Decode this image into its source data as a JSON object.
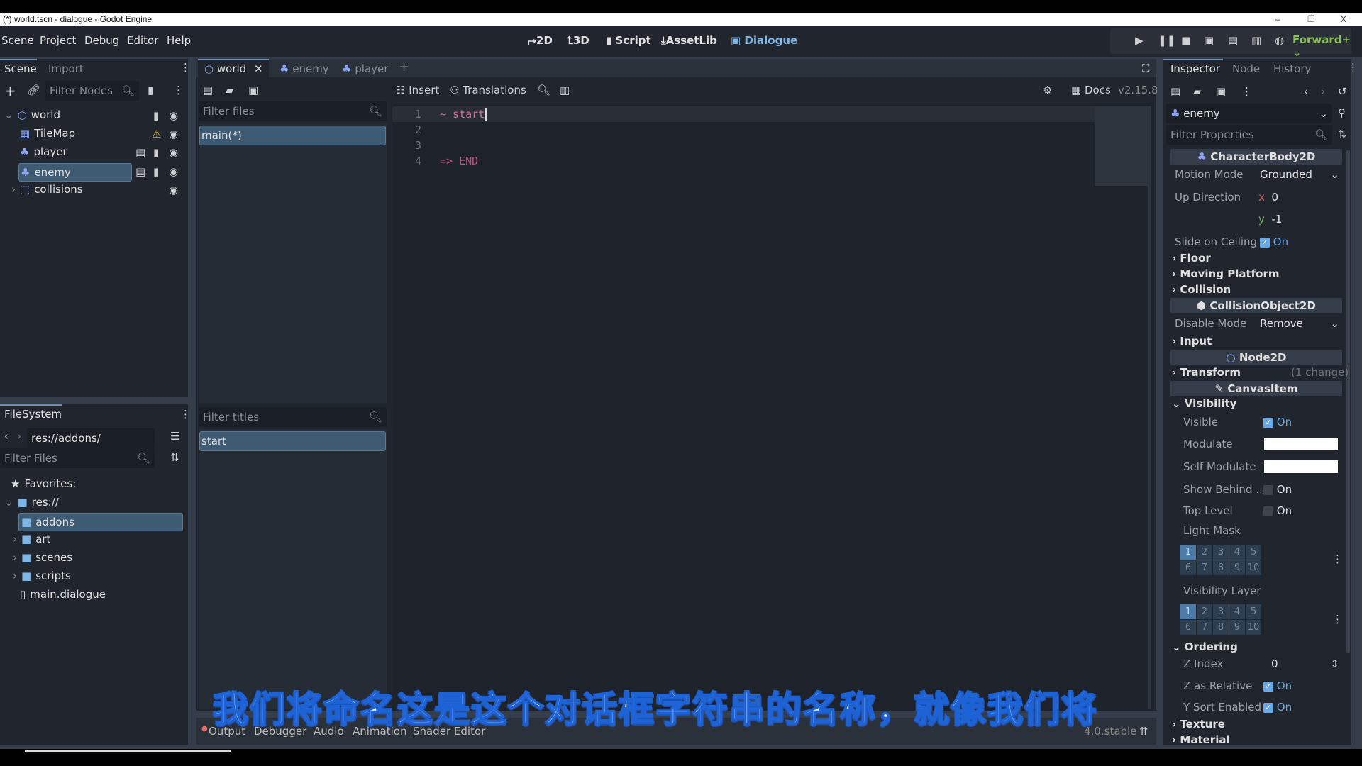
{
  "window": {
    "title": "(*) world.tscn - dialogue - Godot Engine",
    "minimize": "–",
    "maximize": "❐",
    "close": "X"
  },
  "menu": [
    "Scene",
    "Project",
    "Debug",
    "Editor",
    "Help"
  ],
  "main_screens": [
    {
      "label": "2D",
      "icon": "2d-icon"
    },
    {
      "label": "3D",
      "icon": "3d-icon"
    },
    {
      "label": "Script",
      "icon": "script-icon"
    },
    {
      "label": "AssetLib",
      "icon": "assetlib-icon"
    },
    {
      "label": "Dialogue",
      "icon": "dialogue-icon",
      "active": true
    }
  ],
  "renderer": "Forward+",
  "scene_dock": {
    "tabs": [
      "Scene",
      "Import"
    ],
    "filter_placeholder": "Filter Nodes",
    "tree": [
      {
        "name": "world",
        "icon": "node2d-icon"
      },
      {
        "name": "TileMap",
        "icon": "tilemap-icon",
        "warning": true
      },
      {
        "name": "player",
        "icon": "characterbody-icon"
      },
      {
        "name": "enemy",
        "icon": "characterbody-icon",
        "selected": true
      },
      {
        "name": "collisions",
        "icon": "collision-icon"
      }
    ]
  },
  "filesystem": {
    "tab": "FileSystem",
    "path": "res://addons/",
    "filter_placeholder": "Filter Files",
    "favorites": "Favorites:",
    "root": "res://",
    "items": [
      {
        "name": "addons",
        "type": "folder",
        "selected": true
      },
      {
        "name": "art",
        "type": "folder"
      },
      {
        "name": "scenes",
        "type": "folder"
      },
      {
        "name": "scripts",
        "type": "folder"
      },
      {
        "name": "main.dialogue",
        "type": "file"
      }
    ]
  },
  "scene_tabs": [
    {
      "label": "world",
      "active": true
    },
    {
      "label": "enemy"
    },
    {
      "label": "player"
    }
  ],
  "dialogue": {
    "toolbar": {
      "insert": "Insert",
      "translations": "Translations",
      "docs": "Docs",
      "version": "v2.15.8"
    },
    "files_filter": "Filter files",
    "files": [
      "main(*)"
    ],
    "titles_filter": "Filter titles",
    "titles": [
      "start"
    ],
    "code": [
      {
        "n": "1",
        "text": "~ start"
      },
      {
        "n": "2",
        "text": ""
      },
      {
        "n": "3",
        "text": ""
      },
      {
        "n": "4",
        "text": "=> END"
      }
    ]
  },
  "bottom": {
    "tabs": [
      "Output",
      "Debugger",
      "Audio",
      "Animation",
      "Shader Editor"
    ],
    "version": "4.0.stable"
  },
  "subtitle": "我们将命名这是这个对话框字符串的名称，就像我们将",
  "inspector": {
    "tabs": [
      "Inspector",
      "Node",
      "History"
    ],
    "object": "enemy",
    "filter_placeholder": "Filter Properties",
    "sections": {
      "characterbody": "CharacterBody2D",
      "collisionobject": "CollisionObject2D",
      "node2d": "Node2D",
      "canvasitem": "CanvasItem"
    },
    "motion_mode": {
      "label": "Motion Mode",
      "value": "Grounded"
    },
    "up_direction": {
      "label": "Up Direction",
      "x": "0",
      "y": "-1"
    },
    "slide_on_ceiling": {
      "label": "Slide on Ceiling",
      "value": "On"
    },
    "groups": {
      "floor": "Floor",
      "moving_platform": "Moving Platform",
      "collision": "Collision",
      "input": "Input",
      "transform": "Transform",
      "transform_note": "(1 change)",
      "visibility": "Visibility",
      "ordering": "Ordering",
      "texture": "Texture",
      "material": "Material"
    },
    "disable_mode": {
      "label": "Disable Mode",
      "value": "Remove"
    },
    "visible": {
      "label": "Visible",
      "value": "On"
    },
    "modulate": {
      "label": "Modulate",
      "color": "#ffffff"
    },
    "self_modulate": {
      "label": "Self Modulate",
      "color": "#ffffff"
    },
    "show_behind": {
      "label": "Show Behind ...",
      "value": "On"
    },
    "top_level": {
      "label": "Top Level",
      "value": "On"
    },
    "light_mask": {
      "label": "Light Mask",
      "layers": [
        "1",
        "2",
        "3",
        "4",
        "5",
        "6",
        "7",
        "8",
        "9",
        "10"
      ]
    },
    "visibility_layer": {
      "label": "Visibility Layer",
      "layers": [
        "1",
        "2",
        "3",
        "4",
        "5",
        "6",
        "7",
        "8",
        "9",
        "10"
      ]
    },
    "z_index": {
      "label": "Z Index",
      "value": "0"
    },
    "z_relative": {
      "label": "Z as Relative",
      "value": "On"
    },
    "y_sort": {
      "label": "Y Sort Enabled",
      "value": "On"
    }
  },
  "colors": {
    "accent": "#6aa8e8",
    "base": "#363d4a",
    "panel": "#21262e",
    "dialogue_keyword": "#d36c9b"
  }
}
